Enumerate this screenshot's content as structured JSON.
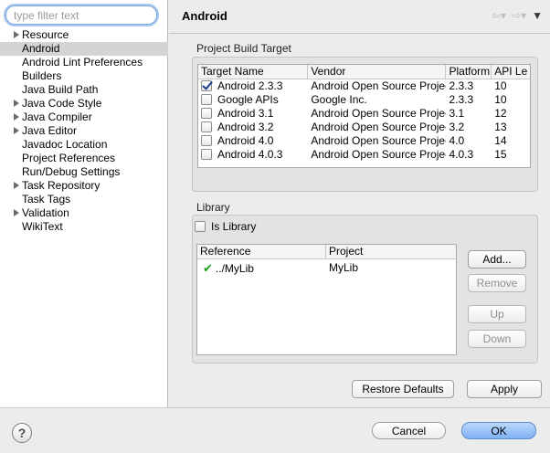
{
  "filter": {
    "placeholder": "type filter text"
  },
  "tree": {
    "items": [
      {
        "label": "Resource",
        "has_children": true
      },
      {
        "label": "Android",
        "has_children": false,
        "selected": true
      },
      {
        "label": "Android Lint Preferences",
        "has_children": false
      },
      {
        "label": "Builders",
        "has_children": false
      },
      {
        "label": "Java Build Path",
        "has_children": false
      },
      {
        "label": "Java Code Style",
        "has_children": true
      },
      {
        "label": "Java Compiler",
        "has_children": true
      },
      {
        "label": "Java Editor",
        "has_children": true
      },
      {
        "label": "Javadoc Location",
        "has_children": false
      },
      {
        "label": "Project References",
        "has_children": false
      },
      {
        "label": "Run/Debug Settings",
        "has_children": false
      },
      {
        "label": "Task Repository",
        "has_children": true
      },
      {
        "label": "Task Tags",
        "has_children": false
      },
      {
        "label": "Validation",
        "has_children": true
      },
      {
        "label": "WikiText",
        "has_children": false
      }
    ]
  },
  "page": {
    "title": "Android",
    "nav": {
      "back_icon": "back-arrow-icon",
      "forward_icon": "forward-arrow-icon",
      "menu_icon": "view-menu-icon"
    }
  },
  "build_target": {
    "group_label": "Project Build Target",
    "columns": [
      "Target Name",
      "Vendor",
      "Platform",
      "API Le"
    ],
    "rows": [
      {
        "checked": true,
        "name": "Android 2.3.3",
        "vendor": "Android Open Source Project",
        "platform": "2.3.3",
        "api": "10"
      },
      {
        "checked": false,
        "name": "Google APIs",
        "vendor": "Google Inc.",
        "platform": "2.3.3",
        "api": "10"
      },
      {
        "checked": false,
        "name": "Android 3.1",
        "vendor": "Android Open Source Project",
        "platform": "3.1",
        "api": "12"
      },
      {
        "checked": false,
        "name": "Android 3.2",
        "vendor": "Android Open Source Project",
        "platform": "3.2",
        "api": "13"
      },
      {
        "checked": false,
        "name": "Android 4.0",
        "vendor": "Android Open Source Project",
        "platform": "4.0",
        "api": "14"
      },
      {
        "checked": false,
        "name": "Android 4.0.3",
        "vendor": "Android Open Source Project",
        "platform": "4.0.3",
        "api": "15"
      }
    ]
  },
  "library": {
    "group_label": "Library",
    "is_library_label": "Is Library",
    "is_library_checked": false,
    "columns": [
      "Reference",
      "Project"
    ],
    "rows": [
      {
        "reference": "../MyLib",
        "project": "MyLib",
        "status_icon": "check-icon"
      }
    ],
    "buttons": {
      "add": "Add...",
      "remove": "Remove",
      "up": "Up",
      "down": "Down"
    }
  },
  "actions": {
    "restore_defaults": "Restore Defaults",
    "apply": "Apply"
  },
  "footer": {
    "help_glyph": "?",
    "cancel": "Cancel",
    "ok": "OK"
  },
  "colors": {
    "accent": "#7eb0f3",
    "selection": "#d4d4d4",
    "check": "#19a319"
  }
}
